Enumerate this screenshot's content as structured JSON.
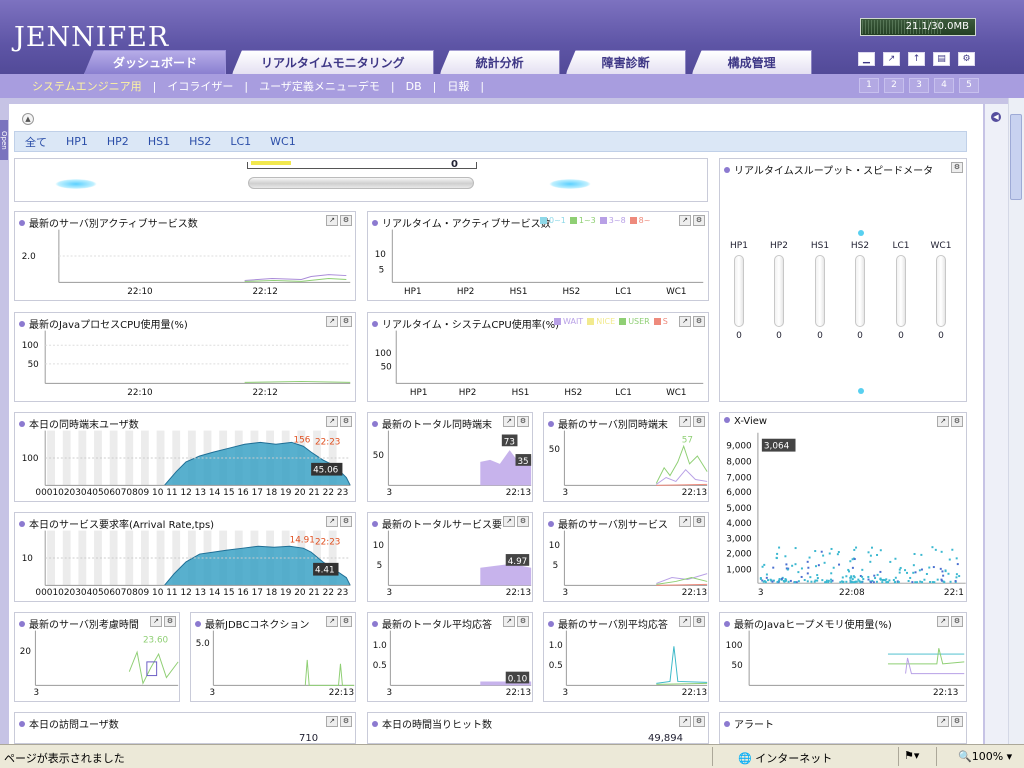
{
  "app": {
    "logo": "JENNIFER",
    "memory": "21.1/30.0MB"
  },
  "tabs": [
    "ダッシュボード",
    "リアルタイムモニタリング",
    "統計分析",
    "障害診断",
    "構成管理"
  ],
  "active_tab": 0,
  "subnav": [
    "システムエンジニア用",
    "イコライザー",
    "ユーザ定義メニューデモ",
    "DB",
    "日報"
  ],
  "page_buttons": [
    "1",
    "2",
    "3",
    "4",
    "5"
  ],
  "tools": [
    "minimize-icon",
    "popout-icon",
    "export-icon",
    "print-icon",
    "settings-icon"
  ],
  "filters": [
    "全て",
    "HP1",
    "HP2",
    "HS1",
    "HS2",
    "LC1",
    "WC1"
  ],
  "side_tab": "Open",
  "gauge_top": {
    "value": "0"
  },
  "panels": {
    "active_service": {
      "title": "最新のサーバ別アクティブサービス数",
      "y_ticks": [
        "2.0"
      ],
      "x_ticks": [
        "22:10",
        "22:12"
      ]
    },
    "rt_active": {
      "title": "リアルタイム・アクティブサービス数",
      "legend": [
        {
          "label": "0~1",
          "color": "#8ed8e8"
        },
        {
          "label": "1~3",
          "color": "#8fcf74"
        },
        {
          "label": "3~8",
          "color": "#b8a0e6"
        },
        {
          "label": "8~",
          "color": "#ee8a7c"
        }
      ],
      "y_ticks": [
        "10",
        "5"
      ],
      "x_ticks": [
        "HP1",
        "HP2",
        "HS1",
        "HS2",
        "LC1",
        "WC1"
      ]
    },
    "java_cpu": {
      "title": "最新のJavaプロセスCPU使用量(%)",
      "y_ticks": [
        "100",
        "50"
      ],
      "x_ticks": [
        "22:10",
        "22:12"
      ]
    },
    "rt_cpu": {
      "title": "リアルタイム・システムCPU使用率(%)",
      "legend": [
        {
          "label": "WAIT",
          "color": "#b8a0e6"
        },
        {
          "label": "NICE",
          "color": "#f2ea8e"
        },
        {
          "label": "USER",
          "color": "#8fcf74"
        },
        {
          "label": "S",
          "color": "#ee8a7c"
        }
      ],
      "y_ticks": [
        "100",
        "50"
      ],
      "x_ticks": [
        "HP1",
        "HP2",
        "HS1",
        "HS2",
        "LC1",
        "WC1"
      ]
    },
    "throughput": {
      "title": "リアルタイムスループット・スピードメータ",
      "servers": [
        "HP1",
        "HP2",
        "HS1",
        "HS2",
        "LC1",
        "WC1"
      ],
      "values": [
        "0",
        "0",
        "0",
        "0",
        "0",
        "0"
      ]
    },
    "concurrent_users": {
      "title": "本日の同時端末ユーザ数",
      "y_ticks": [
        "100"
      ],
      "x_labels": "00010203040506070809 10 11 12 13 14 15 16 17 18 19 20 21 22 23",
      "peak_value": "156",
      "peak_time": "22:23",
      "current_value": "45.06"
    },
    "total_concurrent": {
      "title": "最新のトータル同時端末",
      "y_ticks": [
        "50"
      ],
      "x_ticks": [
        "3",
        "22:13"
      ],
      "labels": [
        "73",
        "35"
      ]
    },
    "server_concurrent": {
      "title": "最新のサーバ別同時端末",
      "y_ticks": [
        "50"
      ],
      "x_ticks": [
        "3",
        "22:13"
      ],
      "labels": [
        "57"
      ]
    },
    "xview": {
      "title": "X-View",
      "y_ticks": [
        "9,000",
        "8,000",
        "7,000",
        "6,000",
        "5,000",
        "4,000",
        "3,000",
        "2,000",
        "1,000"
      ],
      "x_ticks": [
        "3",
        "22:08",
        "22:1"
      ],
      "max_label": "3,064"
    },
    "arrival_rate": {
      "title": "本日のサービス要求率(Arrival Rate,tps)",
      "y_ticks": [
        "10"
      ],
      "x_labels": "00010203040506070809 10 11 12 13 14 15 16 17 18 19 20 21 22 23",
      "peak_value": "14.91",
      "peak_time": "22:23",
      "current_value": "4.41"
    },
    "total_service": {
      "title": "最新のトータルサービス要",
      "y_ticks": [
        "10",
        "5"
      ],
      "x_ticks": [
        "3",
        "22:13"
      ],
      "labels": [
        "4.97"
      ]
    },
    "server_service": {
      "title": "最新のサーバ別サービス",
      "y_ticks": [
        "10",
        "5"
      ],
      "x_ticks": [
        "3",
        "22:13"
      ]
    },
    "think_time": {
      "title": "最新のサーバ別考慮時間",
      "y_ticks": [
        "20"
      ],
      "x_ticks": [
        "3"
      ],
      "labels": [
        "23.60"
      ]
    },
    "jdbc": {
      "title": "最新JDBCコネクション",
      "y_ticks": [
        "5.0"
      ],
      "x_ticks": [
        "3",
        "22:13"
      ]
    },
    "total_response": {
      "title": "最新のトータル平均応答",
      "y_ticks": [
        "1.0",
        "0.5"
      ],
      "x_ticks": [
        "3",
        "22:13"
      ],
      "labels": [
        "0.10"
      ]
    },
    "server_response": {
      "title": "最新のサーバ別平均応答",
      "y_ticks": [
        "1.0",
        "0.5"
      ],
      "x_ticks": [
        "3",
        "22:13"
      ]
    },
    "java_heap": {
      "title": "最新のJavaヒープメモリ使用量(%)",
      "y_ticks": [
        "100",
        "50"
      ],
      "x_ticks": [
        "22:13"
      ]
    },
    "visitors": {
      "title": "本日の訪問ユーザ数",
      "value": "710"
    },
    "hourly_hits": {
      "title": "本日の時間当りヒット数",
      "value": "49,894"
    },
    "alert": {
      "title": "アラート"
    }
  },
  "status": {
    "text": "ページが表示されました",
    "zone": "インターネット",
    "zoom": "100%"
  }
}
